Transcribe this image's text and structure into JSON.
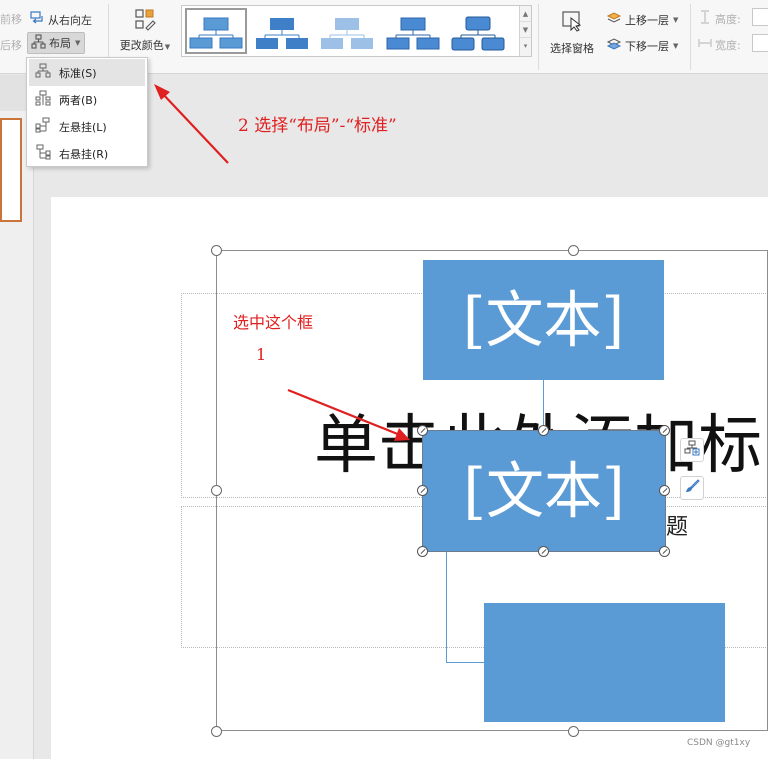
{
  "ribbon": {
    "forward_label": "前移",
    "backward_label": "后移",
    "right_to_left_label": "从右向左",
    "layout_label": "布局",
    "change_color_label": "更改颜色",
    "selection_pane_label": "选择窗格",
    "bring_forward_label": "上移一层",
    "send_backward_label": "下移一层",
    "height_label": "高度:",
    "width_label": "宽度:"
  },
  "layout_menu": {
    "items": [
      {
        "label": "标准(S)",
        "icon": "standard-layout-icon",
        "active": true
      },
      {
        "label": "两者(B)",
        "icon": "both-layout-icon",
        "active": false
      },
      {
        "label": "左悬挂(L)",
        "icon": "left-hanging-layout-icon",
        "active": false
      },
      {
        "label": "右悬挂(R)",
        "icon": "right-hanging-layout-icon",
        "active": false
      }
    ]
  },
  "slide": {
    "title_text": "单击此处添加标",
    "subtitle_fragment": "题",
    "nodes": {
      "top_text": "[文本]",
      "middle_text": "[文本]",
      "bottom_text": ""
    }
  },
  "annotations": {
    "step2": "2 选择“布局”-“标准”",
    "step1_text": "选中这个框",
    "step1_number": "1"
  },
  "colors": {
    "node_fill": "#5b9bd5",
    "annotation": "#e02020",
    "slide_thumb_border": "#c8743a"
  },
  "watermark": "CSDN @gt1xy"
}
